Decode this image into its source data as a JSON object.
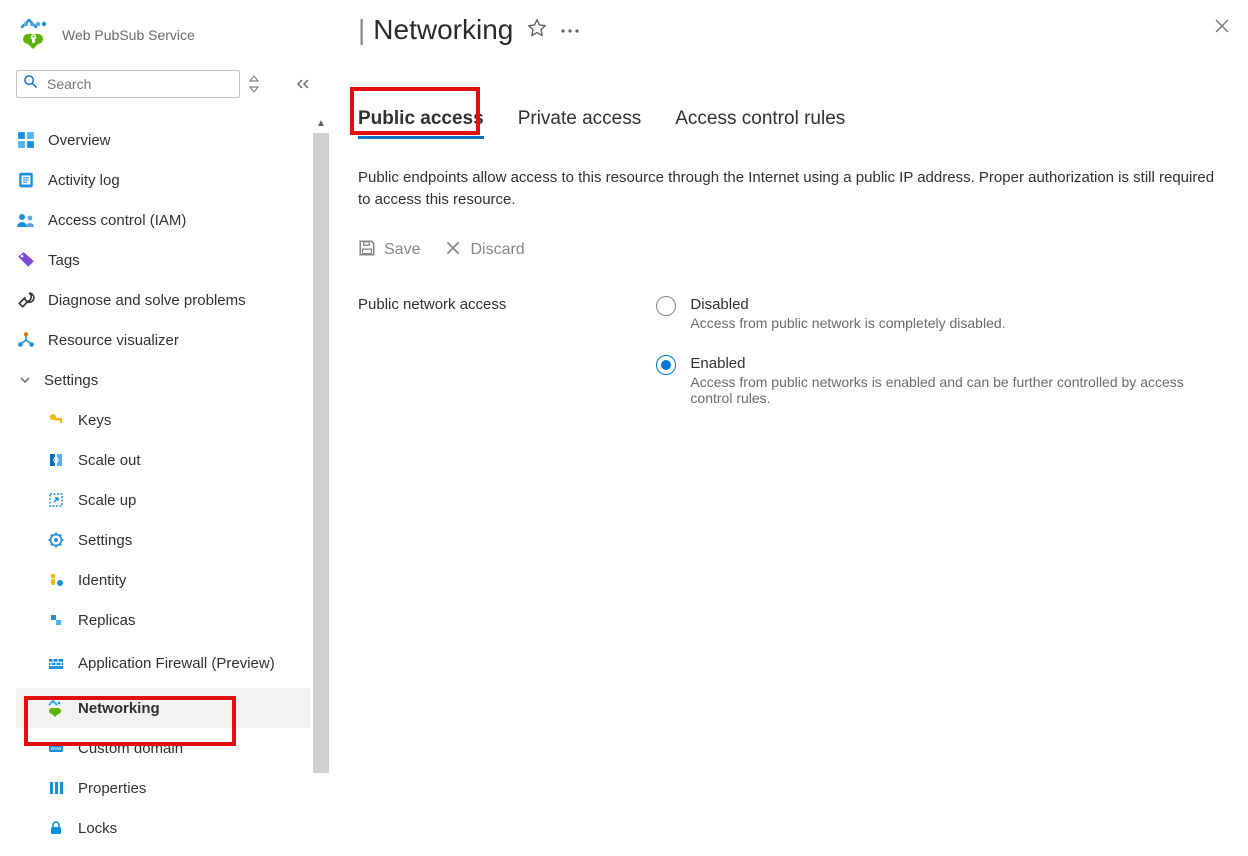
{
  "sidebar": {
    "service_label": "Web PubSub Service",
    "search_placeholder": "Search",
    "items": {
      "overview": "Overview",
      "activity_log": "Activity log",
      "access_control": "Access control (IAM)",
      "tags": "Tags",
      "diagnose": "Diagnose and solve problems",
      "resource_visualizer": "Resource visualizer"
    },
    "settings_group": "Settings",
    "settings_items": {
      "keys": "Keys",
      "scale_out": "Scale out",
      "scale_up": "Scale up",
      "settings": "Settings",
      "identity": "Identity",
      "replicas": "Replicas",
      "app_firewall": "Application Firewall (Preview)",
      "networking": "Networking",
      "custom_domain": "Custom domain",
      "properties": "Properties",
      "locks": "Locks"
    }
  },
  "header": {
    "title": "Networking"
  },
  "tabs": {
    "public": "Public access",
    "private": "Private access",
    "acl": "Access control rules"
  },
  "description": "Public endpoints allow access to this resource through the Internet using a public IP address. Proper authorization is still required to access this resource.",
  "toolbar": {
    "save_label": "Save",
    "discard_label": "Discard"
  },
  "form": {
    "label": "Public network access",
    "disabled": {
      "title": "Disabled",
      "caption": "Access from public network is completely disabled."
    },
    "enabled": {
      "title": "Enabled",
      "caption": "Access from public networks is enabled and can be further controlled by access control rules."
    }
  }
}
